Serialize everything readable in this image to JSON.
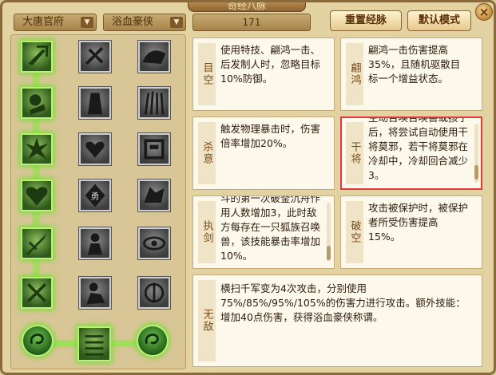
{
  "window": {
    "title": "奇经八脉",
    "close_label": "×"
  },
  "filters": {
    "faction": "大唐官府",
    "school": "浴血豪侠",
    "points": "171"
  },
  "buttons": {
    "reset": "重置经脉",
    "default": "默认模式"
  },
  "skill_icons": {
    "col1": [
      "dagger-icon",
      "fist-icon",
      "burst-icon",
      "heart-shield-icon",
      "sword-icon",
      "strike-icon"
    ],
    "col2": [
      "sword-cross-icon",
      "rock-icon",
      "heart-icon",
      "shield-emblem-icon",
      "warrior-icon",
      "warrior-icon"
    ],
    "col3": [
      "beast-icon",
      "grass-icon",
      "wall-icon",
      "wolf-icon",
      "eye-icon",
      "sword-spin-icon"
    ]
  },
  "cards": [
    {
      "name": "目空",
      "text": "使用特技、翩鸿一击、后发制人时，忽略目标10%防御。"
    },
    {
      "name": "翩鸿",
      "text": "翩鸿一击伤害提高35%，且随机驱散目标一个增益状态。"
    },
    {
      "name": "杀意",
      "text": "触发物理暴击时，伤害倍率增加20%。"
    },
    {
      "name": "干将",
      "text": "主动召唤召唤兽或孩子后，将尝试自动使用干将莫邪，若干将莫邪在冷却中，冷却回合减少3。"
    },
    {
      "name": "执剑",
      "text": "斗的第一次破釜沉舟作用人数增加3，此时敌方每存在一只狐族召唤兽，该技能暴击率增加10%。"
    },
    {
      "name": "破空",
      "text": "攻击被保护时，被保护者所受伤害提高15%。"
    },
    {
      "name": "无敌",
      "text": "横扫千军变为4次攻击，分别使用75%/85%/95%/105%的伤害力进行攻击。额外技能：增加40点伤害，获得浴血豪侠称谓。"
    }
  ]
}
